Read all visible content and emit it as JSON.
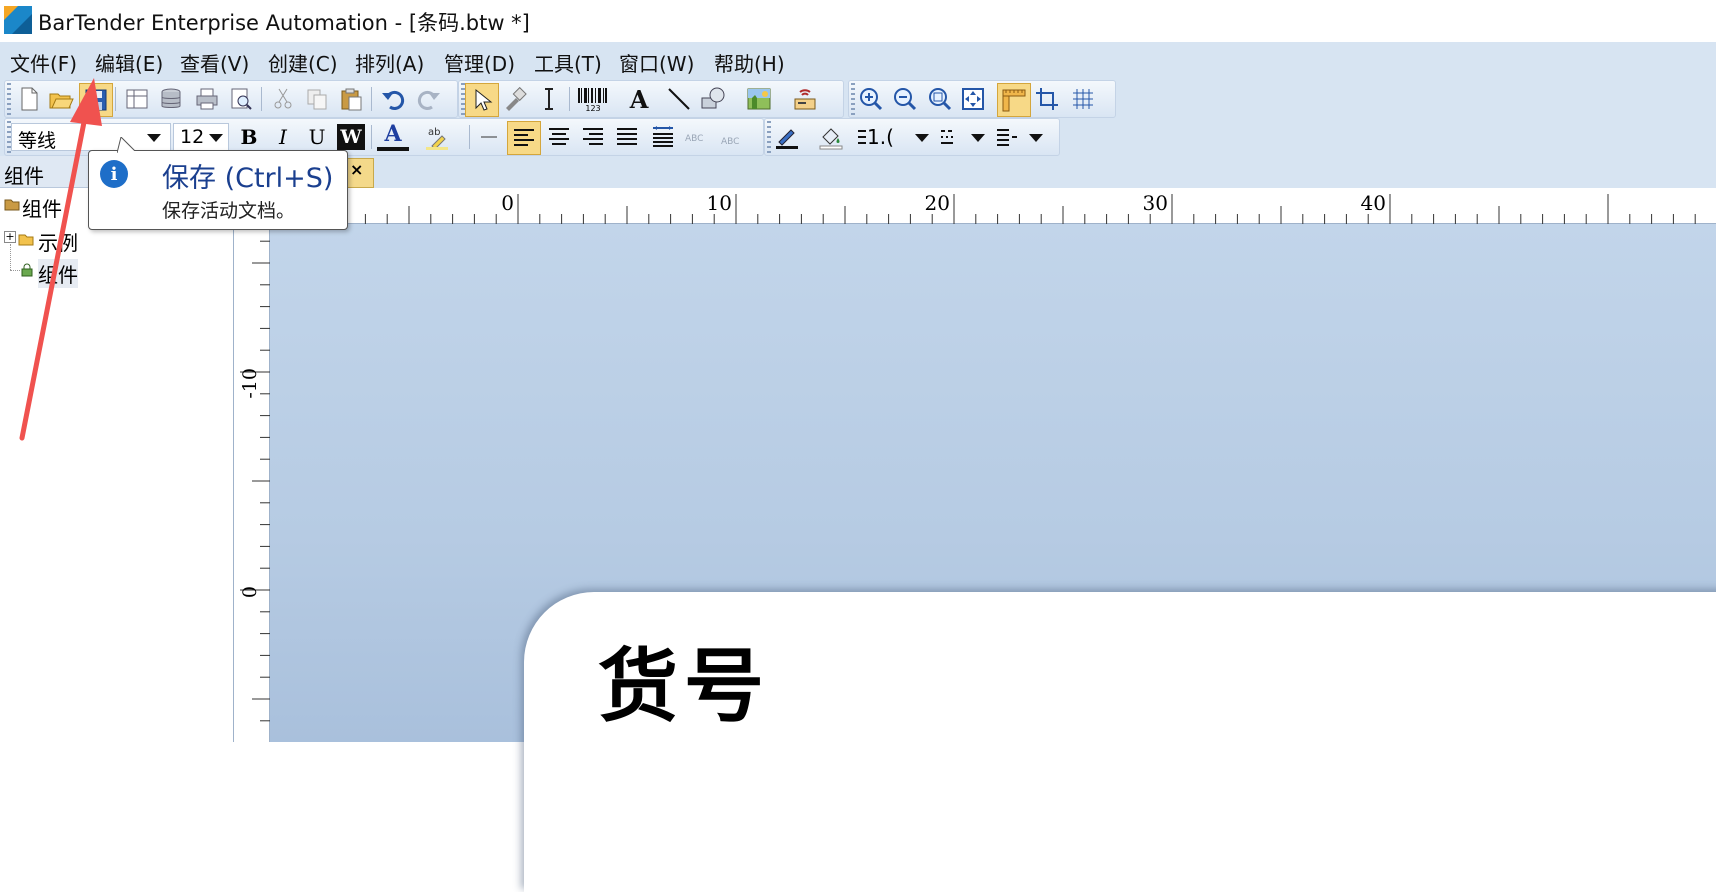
{
  "window": {
    "title": "BarTender Enterprise Automation - [条码.btw *]"
  },
  "menu": [
    "文件(F)",
    "编辑(E)",
    "查看(V)",
    "创建(C)",
    "排列(A)",
    "管理(D)",
    "工具(T)",
    "窗口(W)",
    "帮助(H)"
  ],
  "toolbar_main": {
    "icons": [
      "new-icon",
      "open-icon",
      "save-icon",
      "page-setup-icon",
      "database-icon",
      "print-icon",
      "print-preview-icon",
      "cut-icon",
      "copy-icon",
      "paste-icon",
      "undo-icon",
      "redo-icon",
      "select-arrow-icon",
      "format-painter-icon",
      "text-cursor-icon",
      "barcode-icon",
      "text-icon",
      "line-icon",
      "shape-icon",
      "picture-icon",
      "rfid-icon",
      "zoom-in-icon",
      "zoom-out-icon",
      "zoom-fit-icon",
      "fit-page-icon",
      "ruler-toggle-icon",
      "crop-icon",
      "grid-icon"
    ],
    "barcode_caption": "123"
  },
  "toolbar_format": {
    "font_name": "等线",
    "font_size": "12",
    "bold": "B",
    "italic": "I",
    "underline": "U",
    "reverse": "W",
    "font_color_glyph": "A",
    "line_width": "1.("
  },
  "left_panel": {
    "title": "组件",
    "tree": [
      {
        "label": "组件",
        "level": 0
      },
      {
        "label": "示例",
        "level": 1
      },
      {
        "label": "组件",
        "level": 1
      }
    ]
  },
  "doc_tab": {
    "close": "×"
  },
  "ruler": {
    "horizontal_labels": [
      "0",
      "10",
      "20",
      "30",
      "40"
    ],
    "vertical_labels": [
      "-10",
      "0"
    ]
  },
  "tooltip": {
    "title": "保存 (Ctrl+S)",
    "description": "保存活动文档。"
  },
  "canvas": {
    "label_text": "货号"
  },
  "colors": {
    "menubar_bg": "#d7e4f2",
    "canvas_bg": "#b6cbe3",
    "annotation_arrow": "#f0524f",
    "tooltip_title": "#1a3f8f"
  }
}
